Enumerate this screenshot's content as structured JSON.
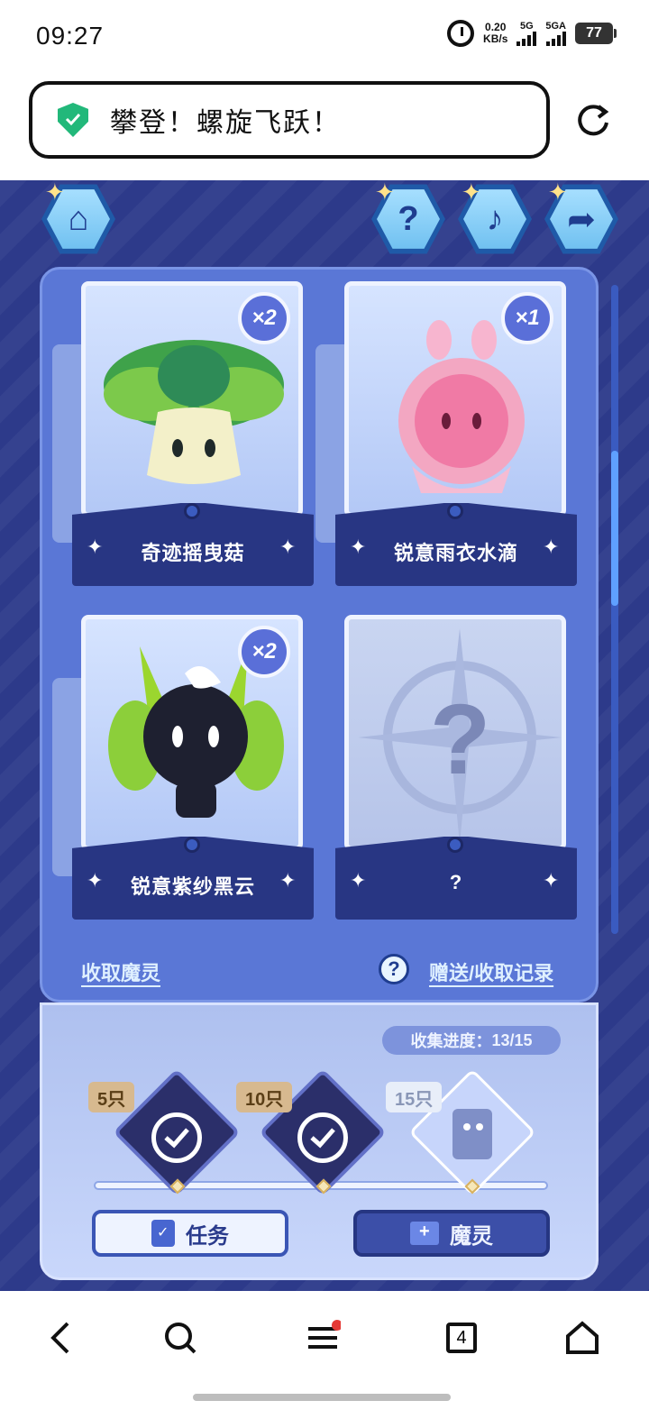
{
  "status_bar": {
    "time": "09:27",
    "speed_value": "0.20",
    "speed_unit": "KB/s",
    "signal1_label": "5G",
    "signal2_label": "5GA",
    "battery": "77"
  },
  "browser": {
    "url_title": "攀登！螺旋飞跃！"
  },
  "cards": [
    {
      "name": "奇迹摇曳菇",
      "count": "×2"
    },
    {
      "name": "锐意雨衣水滴",
      "count": "×1"
    },
    {
      "name": "锐意紫纱黑云",
      "count": "×2"
    },
    {
      "name": "?",
      "count": ""
    }
  ],
  "links": {
    "collect": "收取魔灵",
    "history": "赠送/收取记录"
  },
  "progress": {
    "label": "收集进度：",
    "value": "13/15",
    "current": 13,
    "total": 15,
    "milestones": [
      {
        "label": "5只",
        "done": true
      },
      {
        "label": "10只",
        "done": true
      },
      {
        "label": "15只",
        "done": false
      }
    ]
  },
  "buttons": {
    "task": "任务",
    "spirit": "魔灵"
  },
  "nav": {
    "tabs_count": "4"
  },
  "colors": {
    "game_bg": "#2d3a8a",
    "panel": "#5a77d6",
    "accent": "#22b87a"
  }
}
